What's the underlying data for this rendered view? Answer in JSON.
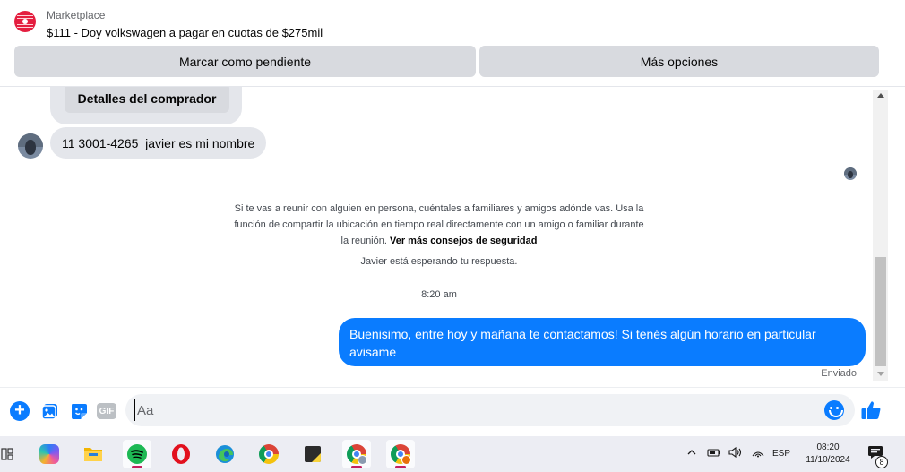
{
  "header": {
    "listing_kind": "Marketplace",
    "listing_title": "$111 - Doy volkswagen a pagar en cuotas de $275mil",
    "mark_pending_label": "Marcar como pendiente",
    "more_options_label": "Más opciones"
  },
  "conversation": {
    "buyer_details_label": "Detalles del comprador",
    "incoming_message": "11 3001-4265  javier es mi nombre",
    "safety_notice": "Si te vas a reunir con alguien en persona, cuéntales a familiares y amigos adónde vas. Usa la función de compartir la ubicación en tiempo real directamente con un amigo o familiar durante la reunión.",
    "safety_link": "Ver más consejos de seguridad",
    "waiting_notice": "Javier está esperando tu respuesta.",
    "timestamp": "8:20 am",
    "outgoing_message": "Buenisimo, entre hoy y mañana te contactamos! Si tenés algún horario en particular avisame",
    "delivery_status": "Enviado"
  },
  "composer": {
    "placeholder": "Aa",
    "gif_label": "GIF",
    "accent_color": "#0a7cff"
  },
  "taskbar": {
    "apps": [
      "widgets",
      "copilot",
      "file-explorer",
      "spotify",
      "opera",
      "edge",
      "chrome",
      "notes",
      "chrome-messenger",
      "chrome-profile"
    ],
    "language": "ESP",
    "time": "08:20",
    "date": "11/10/2024",
    "notification_count": "8"
  }
}
